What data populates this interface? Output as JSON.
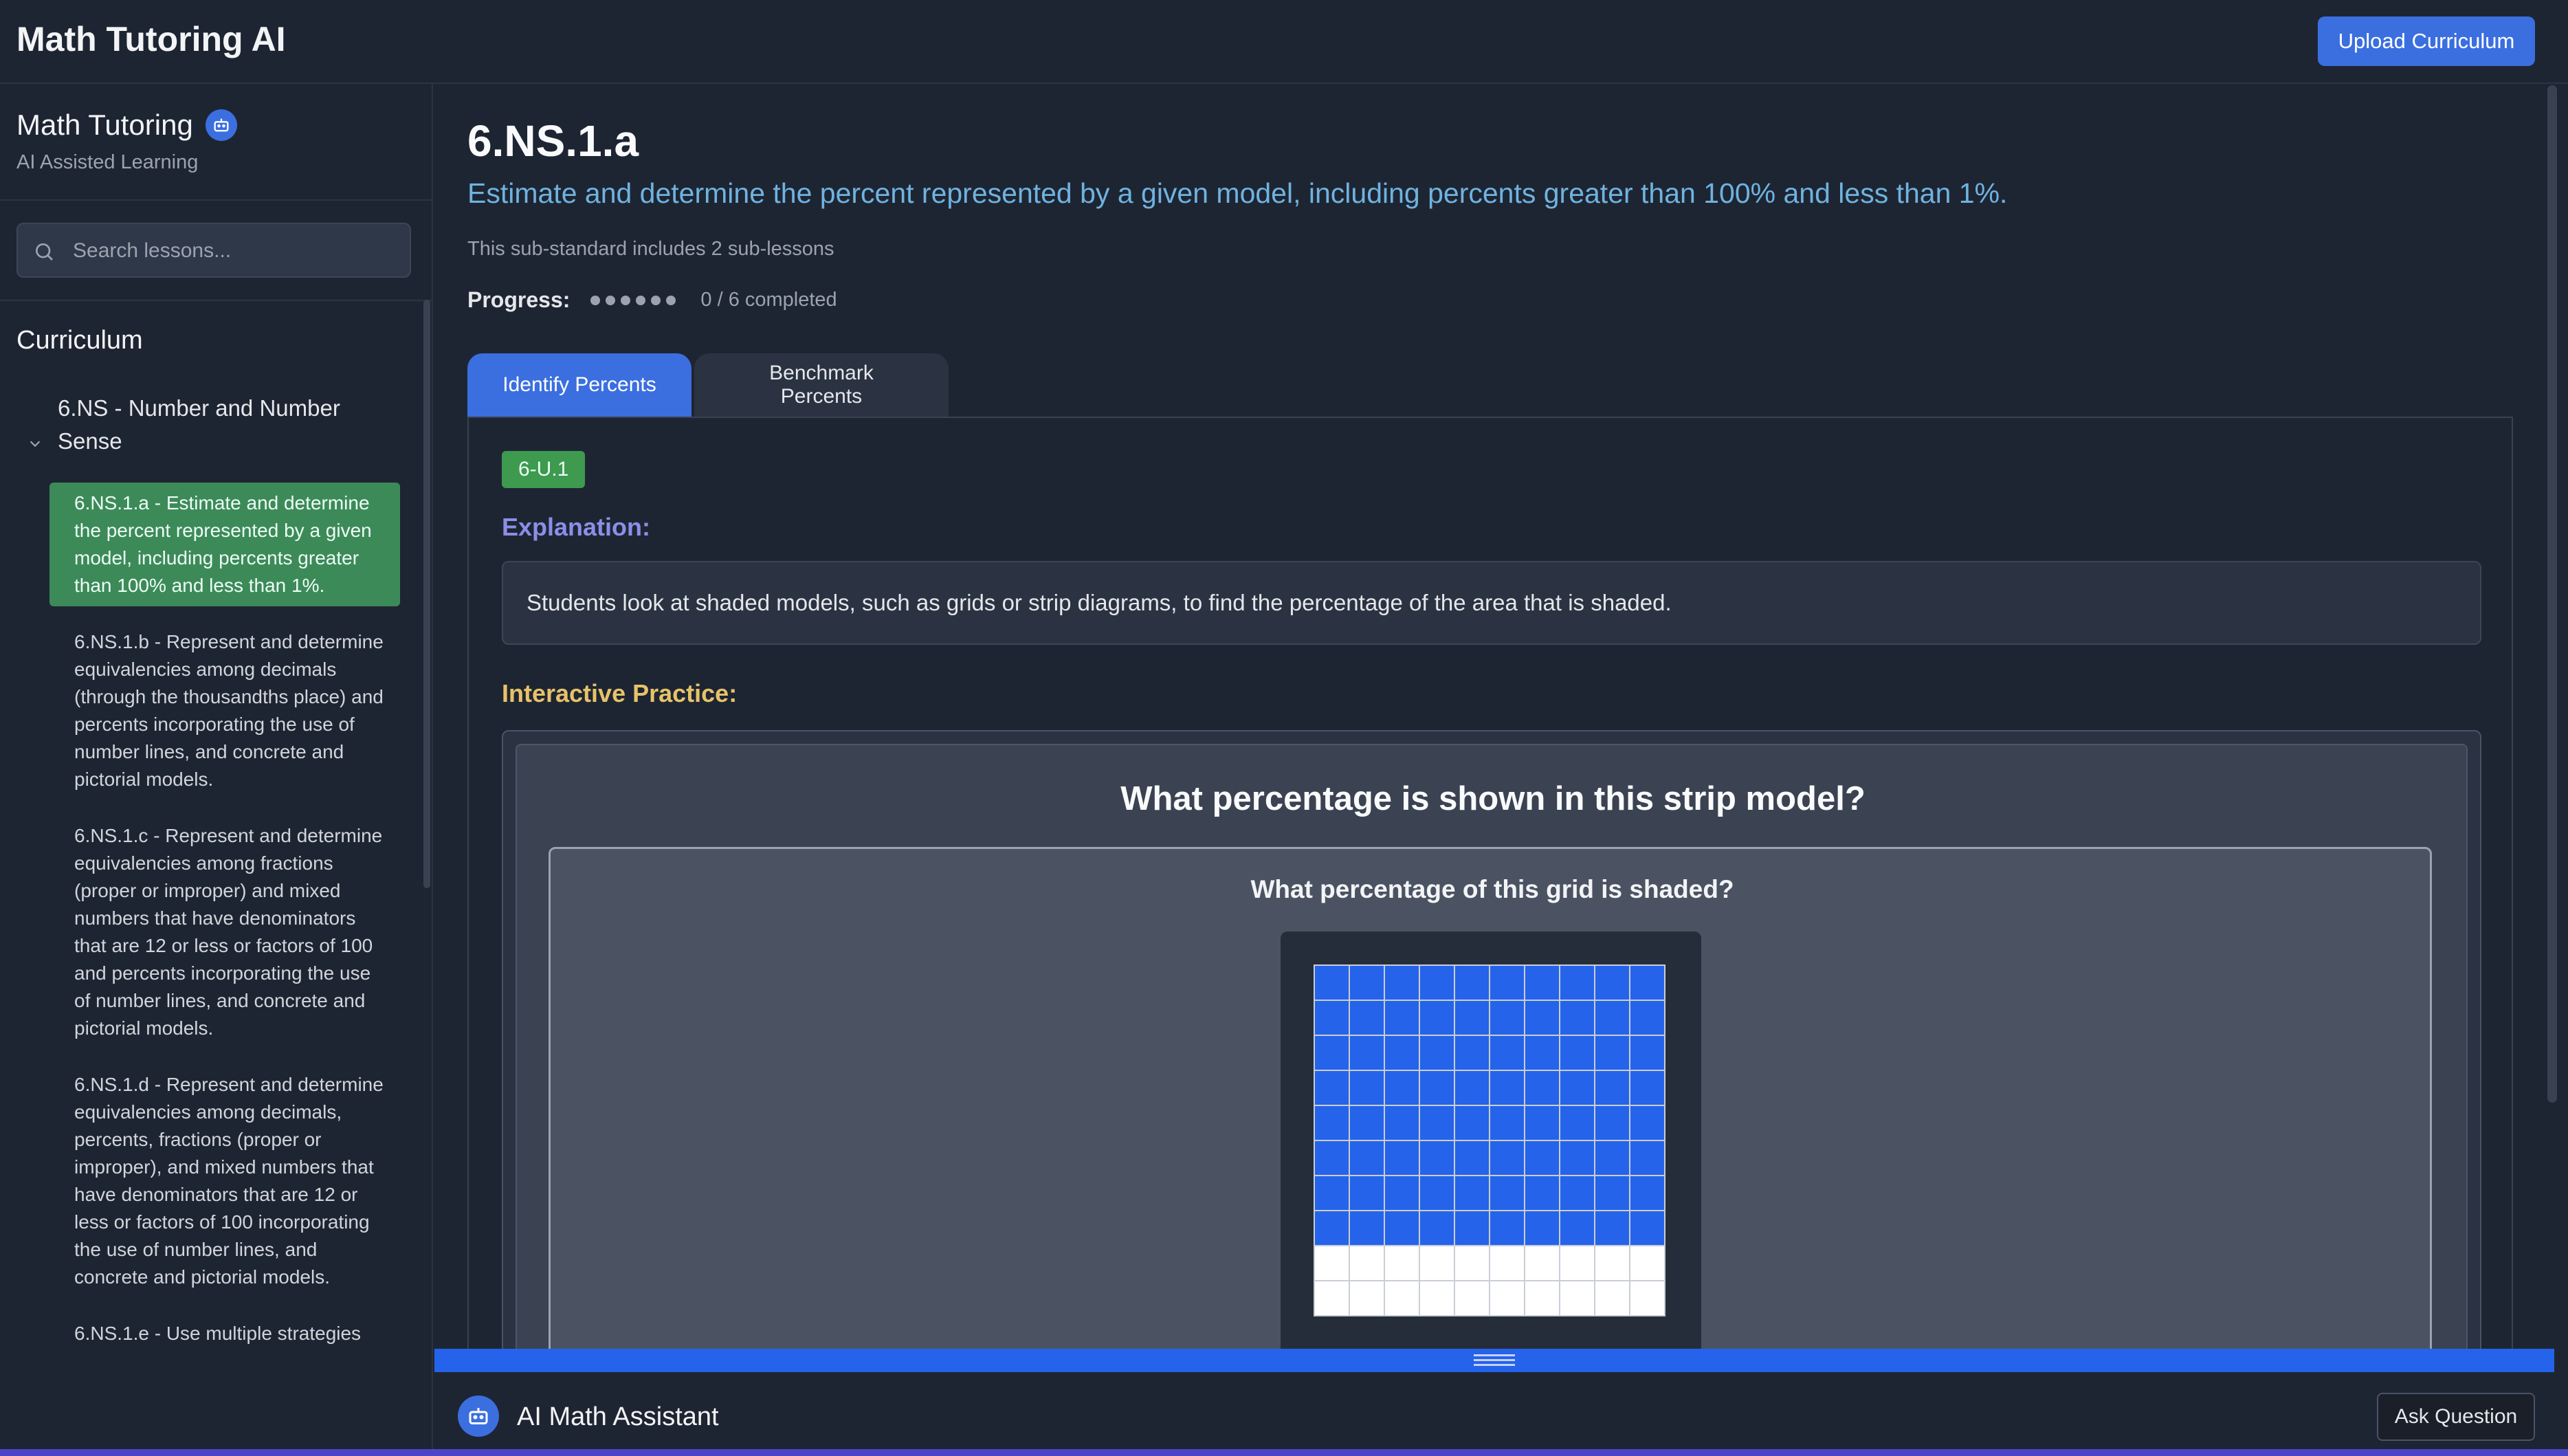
{
  "header": {
    "app_title": "Math Tutoring AI",
    "upload_label": "Upload Curriculum"
  },
  "sidebar": {
    "brand_title": "Math Tutoring",
    "brand_subtitle": "AI Assisted Learning",
    "search_placeholder": "Search lessons...",
    "curriculum_heading": "Curriculum",
    "group_title": "6.NS - Number and Number Sense",
    "lessons": [
      {
        "label": "6.NS.1.a - Estimate and determine the percent represented by a given model, including percents greater than 100% and less than 1%.",
        "active": true
      },
      {
        "label": "6.NS.1.b - Represent and determine equivalencies among decimals (through the thousandths place) and percents incorporating the use of number lines, and concrete and pictorial models.",
        "active": false
      },
      {
        "label": "6.NS.1.c - Represent and determine equivalencies among fractions (proper or improper) and mixed numbers that have denominators that are 12 or less or factors of 100 and percents incorporating the use of number lines, and concrete and pictorial models.",
        "active": false
      },
      {
        "label": "6.NS.1.d - Represent and determine equivalencies among decimals, percents, fractions (proper or improper), and mixed numbers that have denominators that are 12 or less or factors of 100 incorporating the use of number lines, and concrete and pictorial models.",
        "active": false
      },
      {
        "label": "6.NS.1.e - Use multiple strategies",
        "active": false
      }
    ]
  },
  "main": {
    "standard_code": "6.NS.1.a",
    "standard_description": "Estimate and determine the percent represented by a given model, including percents greater than 100% and less than 1%.",
    "sub_count_text": "This sub-standard includes 2 sub-lessons",
    "progress_label": "Progress:",
    "progress_total": 6,
    "progress_completed": 0,
    "progress_text": "0 / 6 completed",
    "tabs": [
      {
        "label": "Identify Percents",
        "active": true
      },
      {
        "label": "Benchmark Percents",
        "active": false
      }
    ],
    "lesson_code": "6-U.1",
    "explanation_title": "Explanation:",
    "explanation_text": "Students look at shaded models, such as grids or strip diagrams, to find the percentage of the area that is shaded.",
    "practice_title": "Interactive Practice:",
    "question_title": "What percentage is shown in this strip model?",
    "question_sub": "What percentage of this grid is shaded?",
    "grid": {
      "rows": 10,
      "cols": 10,
      "shaded_rows": 8,
      "shaded_color": "#2563eb",
      "empty_color": "#ffffff"
    }
  },
  "assistant": {
    "title": "AI Math Assistant",
    "ask_label": "Ask Question"
  }
}
